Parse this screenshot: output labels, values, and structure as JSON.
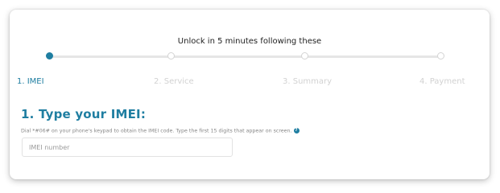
{
  "wizard": {
    "headline": "Unlock in 5 minutes following these",
    "steps": [
      {
        "label": "1. IMEI",
        "state": "active"
      },
      {
        "label": "2. Service",
        "state": "inactive"
      },
      {
        "label": "3. Summary",
        "state": "inactive"
      },
      {
        "label": "4. Payment",
        "state": "inactive"
      }
    ]
  },
  "imei_section": {
    "title": "1. Type your IMEI:",
    "hint": "Dial *#06# on your phone's keypad to obtain the IMEI code. Type the first 15 digits that appear on screen.",
    "help_icon": "question-circle-icon",
    "input": {
      "value": "",
      "placeholder": "IMEI number"
    }
  },
  "colors": {
    "accent": "#1f7ea1",
    "inactive": "#d2d2d2",
    "track": "#e6e6e6"
  }
}
